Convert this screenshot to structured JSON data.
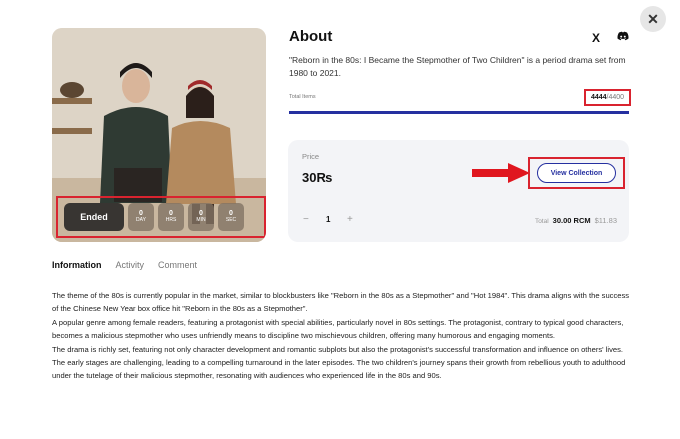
{
  "about": {
    "title": "About",
    "description": "\"Reborn in the 80s: I Became the Stepmother of Two Children\" is a period drama set from 1980 to 2021.",
    "total_items_label": "Total Items",
    "total_current": "4444",
    "total_max": "/4400",
    "progress_fraction": 1.0
  },
  "social": {
    "x_icon": "X",
    "discord_icon": "discord-icon"
  },
  "countdown": {
    "status": "Ended",
    "units": [
      {
        "value": "0",
        "label": "DAY"
      },
      {
        "value": "0",
        "label": "HRS"
      },
      {
        "value": "0",
        "label": "MIN"
      },
      {
        "value": "0",
        "label": "SEC"
      }
    ]
  },
  "price": {
    "label": "Price",
    "value": "30₨",
    "view_collection": "View Collection",
    "quantity": "1",
    "minus": "−",
    "plus": "+",
    "total_label": "Total",
    "total_rcm": "30.00 RCM",
    "total_usd": "$11.83"
  },
  "tabs": [
    {
      "label": "Information",
      "active": true
    },
    {
      "label": "Activity",
      "active": false
    },
    {
      "label": "Comment",
      "active": false
    }
  ],
  "information": [
    "The theme of the 80s is currently popular in the market, similar to blockbusters like \"Reborn in the 80s as a Stepmother\" and \"Hot 1984\". This drama aligns with the success of the Chinese New Year box office hit \"Reborn in the 80s as a Stepmother\".",
    "A popular genre among female readers, featuring a protagonist with special abilities, particularly novel in 80s settings. The protagonist, contrary to typical good characters, becomes a malicious stepmother who uses unfriendly means to discipline two mischievous children, offering many humorous and engaging moments.",
    "The drama is richly set, featuring not only character development and romantic subplots but also the protagonist's successful transformation and influence on others' lives. The early stages are challenging, leading to a compelling turnaround in the later episodes. The two children's journey spans their growth from rebellious youth to adulthood under the tutelage of their malicious stepmother, resonating with audiences who experienced life in the 80s and 90s."
  ],
  "colors": {
    "accent": "#2530a0",
    "highlight": "#d9232f",
    "card_bg": "#f3f4f7"
  }
}
